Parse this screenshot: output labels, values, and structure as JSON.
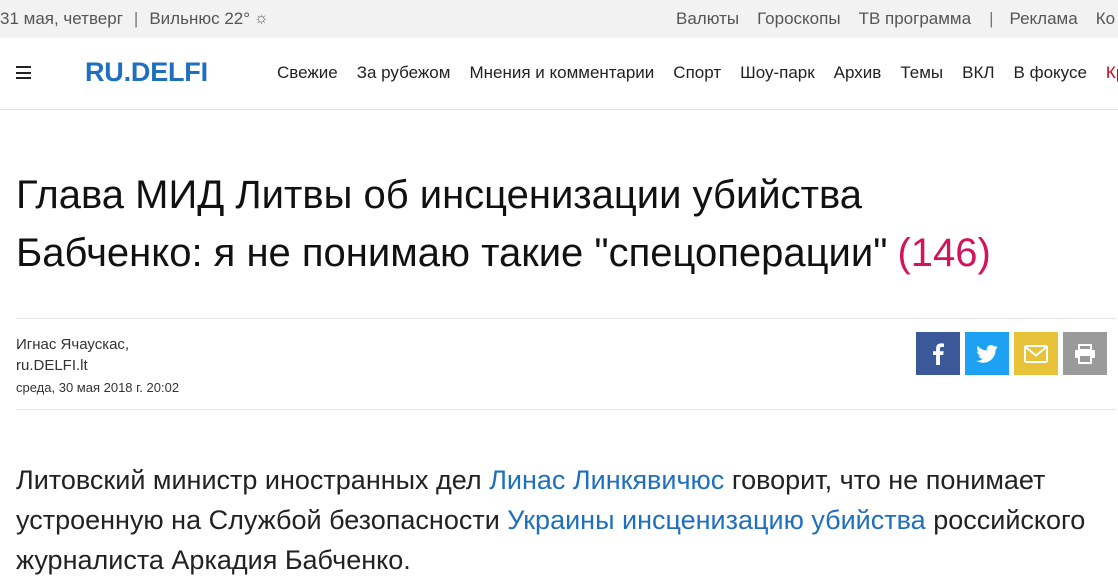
{
  "topbar": {
    "date": "31 мая, четверг",
    "city_weather": "Вильнюс 22°",
    "links": [
      "Валюты",
      "Гороскопы",
      "ТВ программа"
    ],
    "ad": "Реклама",
    "cut": "Ко"
  },
  "nav": {
    "logo": "RU.DELFI",
    "items": [
      "Свежие",
      "За рубежом",
      "Мнения и комментарии",
      "Спорт",
      "Шоу-парк",
      "Архив",
      "Темы",
      "ВКЛ",
      "В фокусе"
    ],
    "item_cut": "Кры"
  },
  "article": {
    "title_line1": "Глава МИД Литвы об инсценизации убийства",
    "title_line2": "Бабченко: я не понимаю такие \"спецоперации\"",
    "comments": "(146)",
    "author": "Игнас Ячаускас,",
    "source": "ru.DELFI.lt",
    "date": "среда, 30 мая 2018 г. 20:02",
    "lead": {
      "p1": "Литовский министр иностранных дел ",
      "link1": "Линас Линкявичюс",
      "p2": " говорит, что не понимает устроенную на Службой безопасности ",
      "link2": "Украины инсценизацию убийства",
      "p3": " российского журналиста Аркадия Бабченко."
    }
  },
  "icons": {
    "facebook": "facebook-icon",
    "twitter": "twitter-icon",
    "mail": "mail-icon",
    "print": "print-icon",
    "menu": "hamburger-icon",
    "weather": "sun-icon"
  },
  "colors": {
    "brand": "#1f6fc0",
    "accent_red": "#d4145a",
    "facebook": "#3b5998",
    "twitter": "#1da1f2",
    "mail": "#e8c33a",
    "print": "#9a9a9a"
  }
}
